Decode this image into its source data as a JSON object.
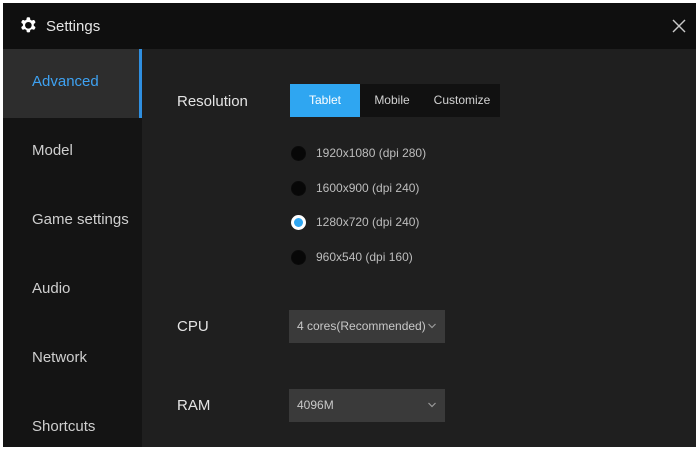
{
  "window": {
    "title": "Settings"
  },
  "sidebar": {
    "items": [
      {
        "label": "Advanced",
        "active": true
      },
      {
        "label": "Model"
      },
      {
        "label": "Game settings"
      },
      {
        "label": "Audio"
      },
      {
        "label": "Network"
      },
      {
        "label": "Shortcuts"
      }
    ]
  },
  "resolution": {
    "label": "Resolution",
    "tabs": [
      {
        "label": "Tablet",
        "active": true
      },
      {
        "label": "Mobile"
      },
      {
        "label": "Customize"
      }
    ],
    "options": [
      {
        "label": "1920x1080  (dpi 280)",
        "selected": false
      },
      {
        "label": "1600x900  (dpi 240)",
        "selected": false
      },
      {
        "label": "1280x720  (dpi 240)",
        "selected": true
      },
      {
        "label": "960x540  (dpi 160)",
        "selected": false
      }
    ]
  },
  "cpu": {
    "label": "CPU",
    "value": "4 cores(Recommended)"
  },
  "ram": {
    "label": "RAM",
    "value": "4096M"
  },
  "colors": {
    "accent": "#2fa6f1",
    "active_sidebar_text": "#3ea2f2",
    "background": "#1f1f1f",
    "sidebar": "#141414",
    "titlebar": "#0f0f0f"
  },
  "icons": {
    "title": "gear-icon",
    "close": "close-icon",
    "dropdown": "chevron-down-icon"
  }
}
